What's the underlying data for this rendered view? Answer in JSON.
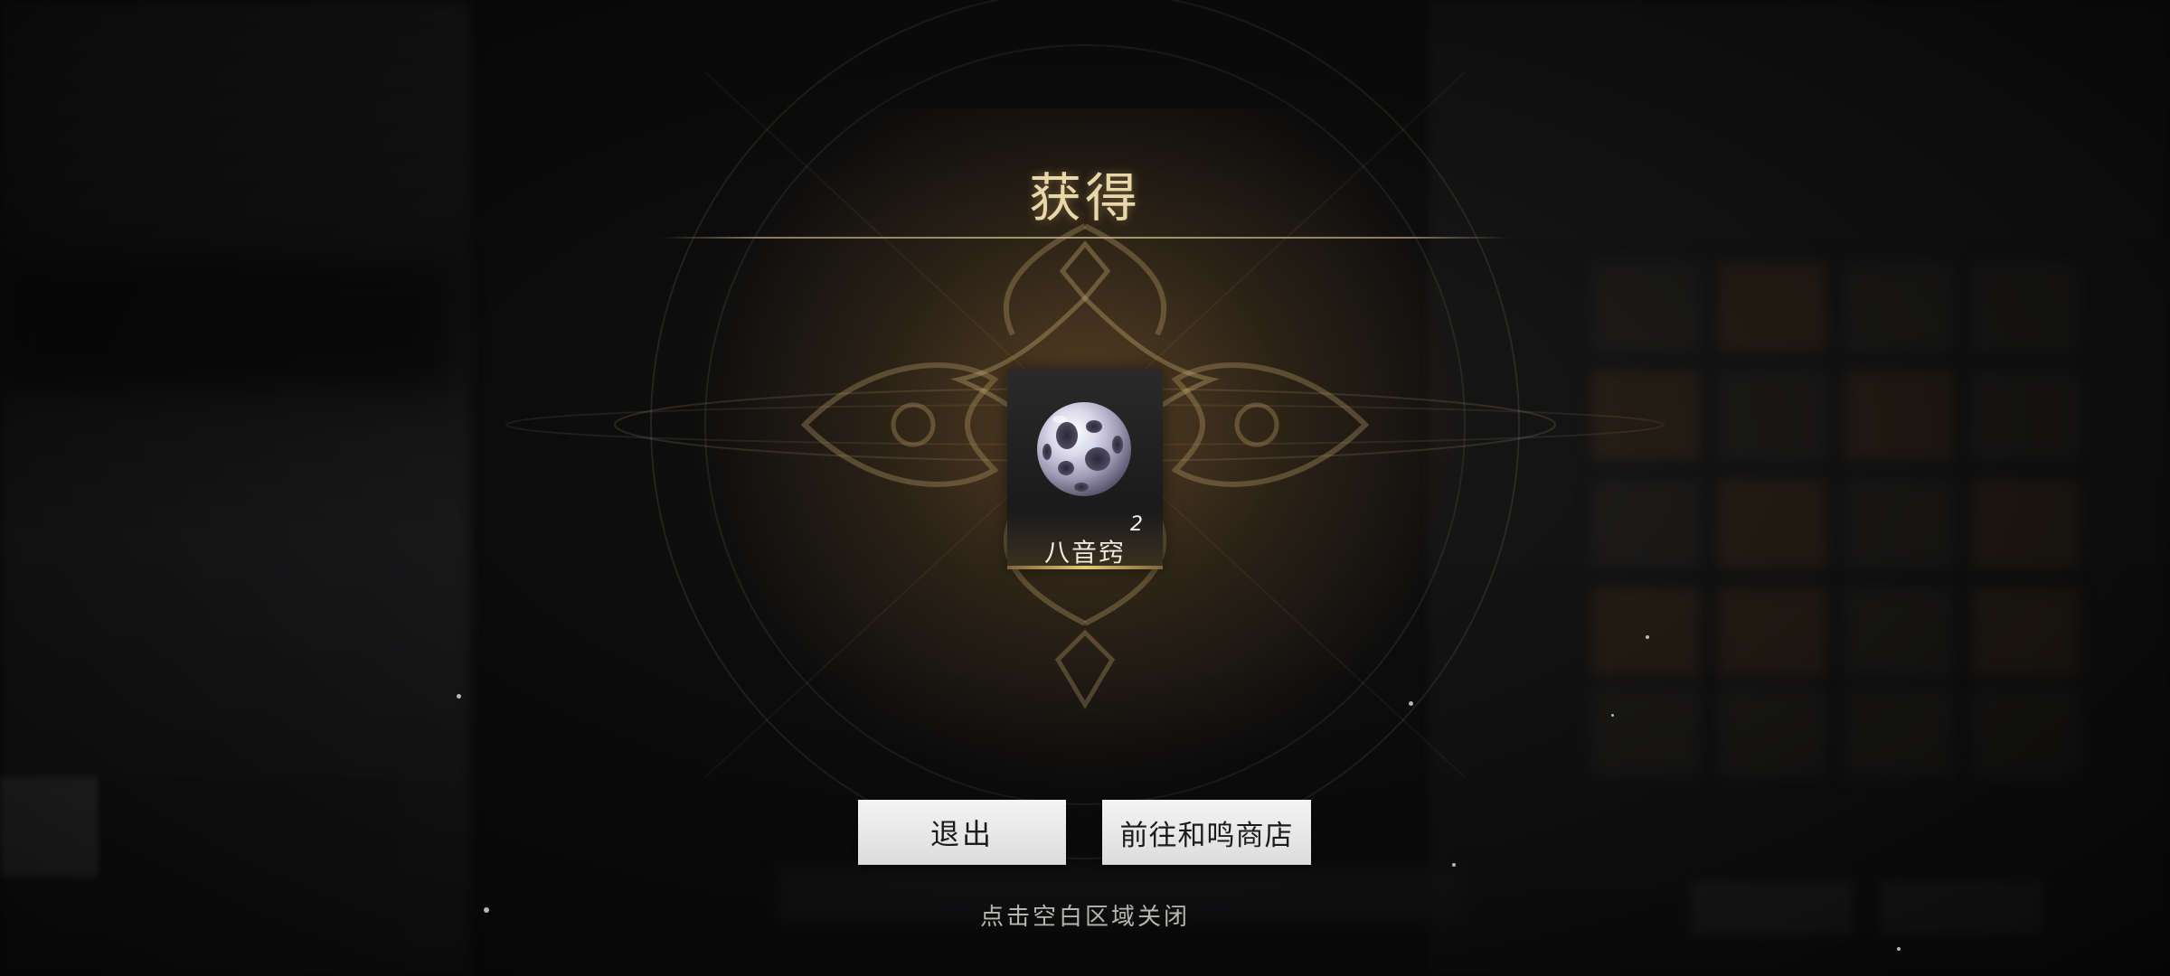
{
  "dialog": {
    "title": "获得",
    "hint": "点击空白区域关闭"
  },
  "reward": {
    "item_name": "八音窍",
    "count": "2",
    "icon": "perforated-pearl-sphere-icon"
  },
  "buttons": {
    "exit_label": "退出",
    "shop_label": "前往和鸣商店"
  },
  "colors": {
    "title_gold": "#e8d7a8",
    "accent_gold": "#e8c77a",
    "button_bg": "#eeeeee",
    "background": "#0d0d0e"
  }
}
